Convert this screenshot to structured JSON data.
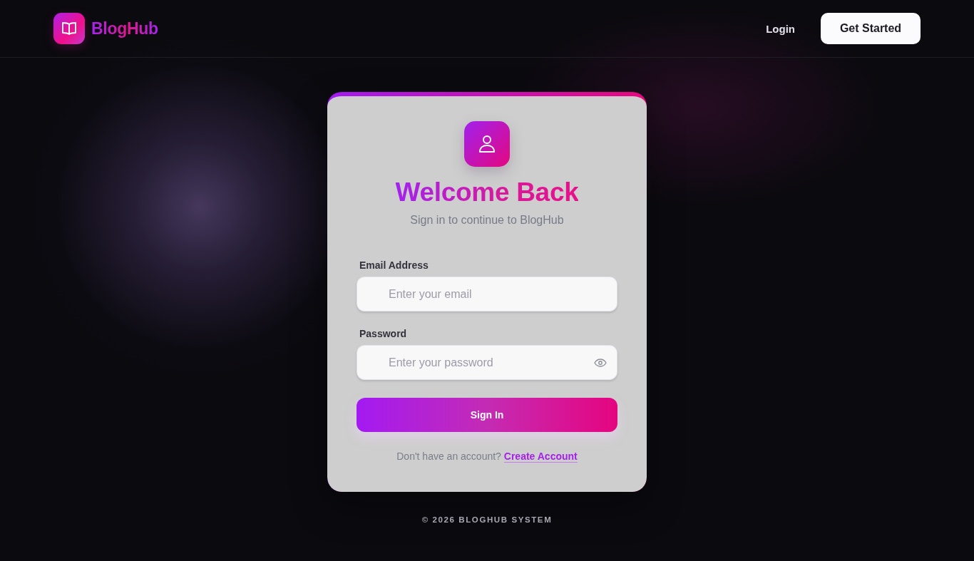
{
  "header": {
    "brand": "BlogHub",
    "nav": [
      {
        "label": "Login",
        "kind": "link"
      },
      {
        "label": "Get Started",
        "kind": "button"
      }
    ]
  },
  "login_card": {
    "title": "Welcome Back",
    "subtitle": "Sign in to continue to BlogHub",
    "fields": [
      {
        "label": "Email Address",
        "placeholder": "Enter your email",
        "kind": "email"
      },
      {
        "label": "Password",
        "placeholder": "Enter your password",
        "kind": "password"
      }
    ],
    "submit": "Sign In",
    "signup_prompt": "Don't have an account?",
    "signup_link": "Create Account"
  },
  "footer": "© 2026 BLOGHUB SYSTEM"
}
